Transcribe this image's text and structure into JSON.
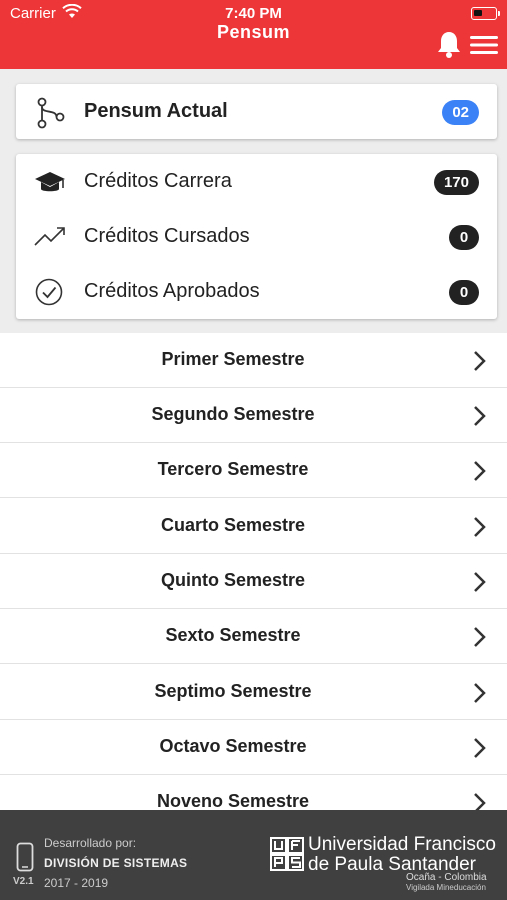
{
  "status_bar": {
    "carrier": "Carrier",
    "time": "7:40 PM"
  },
  "nav": {
    "title": "Pensum",
    "icons": [
      "bell-icon",
      "menu-icon"
    ]
  },
  "pensum_card": {
    "label": "Pensum Actual",
    "badge": "02",
    "badge_color": "#3b82f6",
    "icon": "branch-icon"
  },
  "credits_card": {
    "rows": [
      {
        "label": "Créditos Carrera",
        "value": "170",
        "icon": "graduation-cap-icon"
      },
      {
        "label": "Créditos Cursados",
        "value": "0",
        "icon": "trending-up-icon"
      },
      {
        "label": "Créditos Aprobados",
        "value": "0",
        "icon": "check-circle-icon"
      }
    ],
    "badge_color": "#222222"
  },
  "semesters": [
    "Primer Semestre",
    "Segundo Semestre",
    "Tercero Semestre",
    "Cuarto Semestre",
    "Quinto Semestre",
    "Sexto Semestre",
    "Septimo Semestre",
    "Octavo Semestre",
    "Noveno Semestre"
  ],
  "footer": {
    "developed_by": "Desarrollado por:",
    "division": "DIVISIÓN DE SISTEMAS",
    "years": "2017 - 2019",
    "version": "V2.1",
    "university_line1": "Universidad Francisco",
    "university_line2": "de Paula Santander",
    "location": "Ocaña - Colombia",
    "oversight": "Vigilada Mineducación",
    "logo_text": "UFPS"
  },
  "colors": {
    "header": "#ec3638",
    "footer": "#404040"
  }
}
